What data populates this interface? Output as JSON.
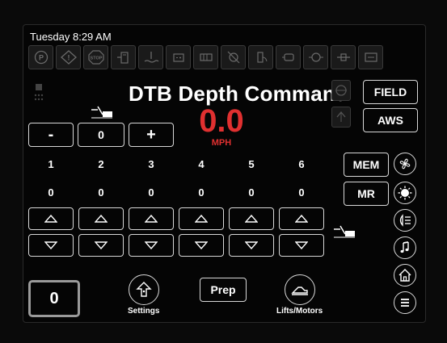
{
  "status": {
    "time": "Tuesday 8:29 AM"
  },
  "warnings": [
    {
      "icon": "parking-brake-icon",
      "text": "(P)"
    },
    {
      "icon": "warning-icon",
      "text": "!"
    },
    {
      "icon": "stop-icon",
      "text": "STOP"
    },
    {
      "icon": "fuel-icon"
    },
    {
      "icon": "coolant-icon"
    },
    {
      "icon": "battery-icon"
    },
    {
      "icon": "transmission-icon"
    },
    {
      "icon": "fan-off-icon"
    },
    {
      "icon": "hydraulic-icon"
    },
    {
      "icon": "engine-icon"
    },
    {
      "icon": "oil-icon"
    },
    {
      "icon": "filter-icon"
    },
    {
      "icon": "pump-icon"
    }
  ],
  "main": {
    "title": "DTB Depth Command",
    "speed_value": "0.0",
    "speed_unit": "MPH",
    "accent_color": "#e03030"
  },
  "depth_control": {
    "minus_label": "-",
    "value": "0",
    "plus_label": "+"
  },
  "sections": {
    "numbers": [
      "1",
      "2",
      "3",
      "4",
      "5",
      "6"
    ],
    "values": [
      "0",
      "0",
      "0",
      "0",
      "0",
      "0"
    ]
  },
  "side_buttons": {
    "field": "FIELD",
    "aws": "AWS",
    "mem": "MEM",
    "mr": "MR"
  },
  "bottom": {
    "counter": "0",
    "settings_label": "Settings",
    "prep_label": "Prep",
    "lifts_label": "Lifts/Motors"
  }
}
